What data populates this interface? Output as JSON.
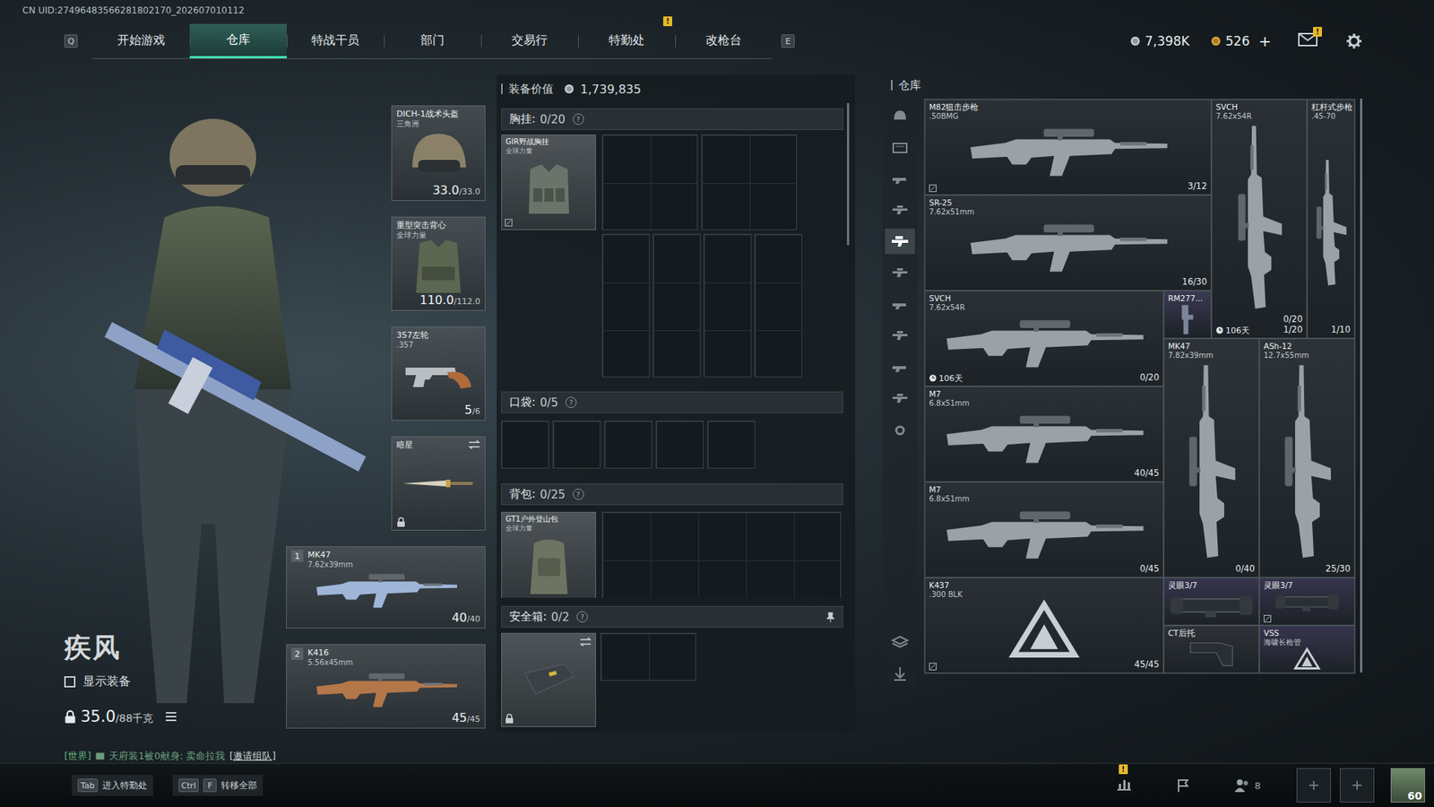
{
  "header": {
    "uid": "CN UID:27496483566281802170_202607010112"
  },
  "nav": {
    "left_key": "Q",
    "right_key": "E",
    "tabs": [
      {
        "label": "开始游戏",
        "selected": false
      },
      {
        "label": "仓库",
        "selected": true
      },
      {
        "label": "特战干员",
        "selected": false
      },
      {
        "label": "部门",
        "selected": false
      },
      {
        "label": "交易行",
        "selected": false
      },
      {
        "label": "特勤处",
        "selected": false,
        "badge": "!"
      },
      {
        "label": "改枪台",
        "selected": false
      }
    ]
  },
  "wallet": {
    "coins": "7,398K",
    "bonds": "526",
    "add": "+"
  },
  "mail": {
    "badge": "!"
  },
  "operator": {
    "name": "疾风",
    "show_equipment": {
      "label": "显示装备",
      "checked": false
    },
    "weight": "35.0",
    "weight_max": "/88千克",
    "weight_locked": true
  },
  "chat": {
    "channel": "[世界]",
    "message": "天府装1被0献身: 卖命拉我",
    "action": "[邀请组队]"
  },
  "equipment": [
    {
      "kind": "helmet",
      "name": "DICH-1战术头盔",
      "sub": "三角洲",
      "value": "33.0",
      "max": "/33.0"
    },
    {
      "kind": "armor",
      "name": "重型突击背心",
      "sub": "全球力量",
      "value": "110.0",
      "max": "/112.0"
    },
    {
      "kind": "pistol",
      "name": "357左轮",
      "sub": ".357",
      "value": "5",
      "max": "/6"
    },
    {
      "kind": "melee",
      "name": "暗星",
      "swappable": true,
      "locked": true
    },
    {
      "kind": "weapon",
      "number": "1",
      "name": "MK47",
      "sub": "7.62x39mm",
      "value": "40",
      "max": "/40"
    },
    {
      "kind": "weapon",
      "number": "2",
      "name": "K416",
      "sub": "5.56x45mm",
      "value": "45",
      "max": "/45"
    }
  ],
  "loadout": {
    "value_label": "装备价值",
    "value": "1,739,835",
    "chest": {
      "label": "胸挂:",
      "count": "0/20",
      "help": "?",
      "item": {
        "name": "GIR野战胸挂",
        "sub": "全球力量",
        "marked": true
      }
    },
    "pockets": {
      "label": "口袋:",
      "count": "0/5",
      "help": "?",
      "slots": [
        {
          "filled": false
        },
        {
          "filled": false
        },
        {
          "filled": false
        },
        {
          "filled": false
        },
        {
          "filled": false
        }
      ]
    },
    "backpack": {
      "label": "背包:",
      "count": "0/25",
      "help": "?",
      "item": {
        "name": "GT1户外登山包",
        "sub": "全球力量"
      }
    },
    "safe": {
      "label": "安全箱:",
      "count": "0/2",
      "help": "?",
      "pinned": true,
      "item": {
        "locked": true,
        "swappable": true
      }
    }
  },
  "warehouse": {
    "title": "仓库",
    "categories": [
      {
        "selected": false
      },
      {
        "selected": false
      },
      {
        "selected": false
      },
      {
        "selected": false
      },
      {
        "selected": true
      },
      {
        "selected": false
      },
      {
        "selected": false
      },
      {
        "selected": false
      },
      {
        "selected": false
      },
      {
        "selected": false
      },
      {
        "selected": false
      },
      {
        "selected": false
      },
      {
        "selected": false
      }
    ],
    "items": [
      {
        "kind": "rifle",
        "name": "M82狙击步枪",
        "sub": ".50BMG",
        "counts": [
          "3/12"
        ],
        "marked": true,
        "color": "#2a3036"
      },
      {
        "kind": "tallrifle",
        "name": "SVCH",
        "sub": "7.62x54R",
        "counts": [
          "0/20",
          "1/20"
        ],
        "timer": "106天",
        "color": "#2a3036"
      },
      {
        "kind": "tallrifle",
        "name": "杠杆式步枪",
        "sub": ".45-70",
        "counts": [
          "1/10"
        ],
        "color": "#2a3036"
      },
      {
        "kind": "rifle",
        "name": "SR-25",
        "sub": "7.62x51mm",
        "counts": [
          "16/30"
        ],
        "color": "#2a3036"
      },
      {
        "kind": "rifle",
        "name": "SVCH",
        "sub": "7.62x54R",
        "counts": [
          "0/20"
        ],
        "timer": "106天",
        "color": "#2a3036"
      },
      {
        "kind": "part",
        "name": "RM277...",
        "counts": [],
        "color": "#3a3952"
      },
      {
        "kind": "tallrifle",
        "name": "MK47",
        "sub": "7.82x39mm",
        "counts": [
          "0/40"
        ],
        "color": "#2d3338"
      },
      {
        "kind": "tallrifle",
        "name": "ASh-12",
        "sub": "12.7x55mm",
        "counts": [
          "25/30"
        ],
        "color": "#2d3338"
      },
      {
        "kind": "rifle",
        "name": "M7",
        "sub": "6.8x51mm",
        "counts": [
          "40/45"
        ],
        "color": "#2a3036"
      },
      {
        "kind": "rifle",
        "name": "M7",
        "sub": "6.8x51mm",
        "counts": [
          "0/45"
        ],
        "color": "#2a3036"
      },
      {
        "kind": "placeholder",
        "name": "K437",
        "sub": ".300 BLK",
        "counts": [
          "45/45"
        ],
        "marked": true,
        "color": "#2a3036"
      },
      {
        "kind": "scope",
        "name": "灵眼3/7",
        "counts": [],
        "color": "#37344e"
      },
      {
        "kind": "scope",
        "name": "灵眼3/7",
        "counts": [],
        "marked": true,
        "color": "#37344e"
      },
      {
        "kind": "stock",
        "name": "CT后托",
        "counts": [],
        "color": "#2e3238"
      },
      {
        "kind": "placeholder",
        "name": "VSS",
        "sub": "海啸长枪管",
        "counts": [],
        "color": "#37344e"
      }
    ]
  },
  "footer": {
    "hints": [
      {
        "keys": [
          "Tab"
        ],
        "label": "进入特勤处"
      },
      {
        "keys": [
          "Ctrl",
          "F"
        ],
        "label": "转移全部"
      }
    ],
    "stats_badge": "!",
    "friends": "8",
    "level": "60"
  }
}
